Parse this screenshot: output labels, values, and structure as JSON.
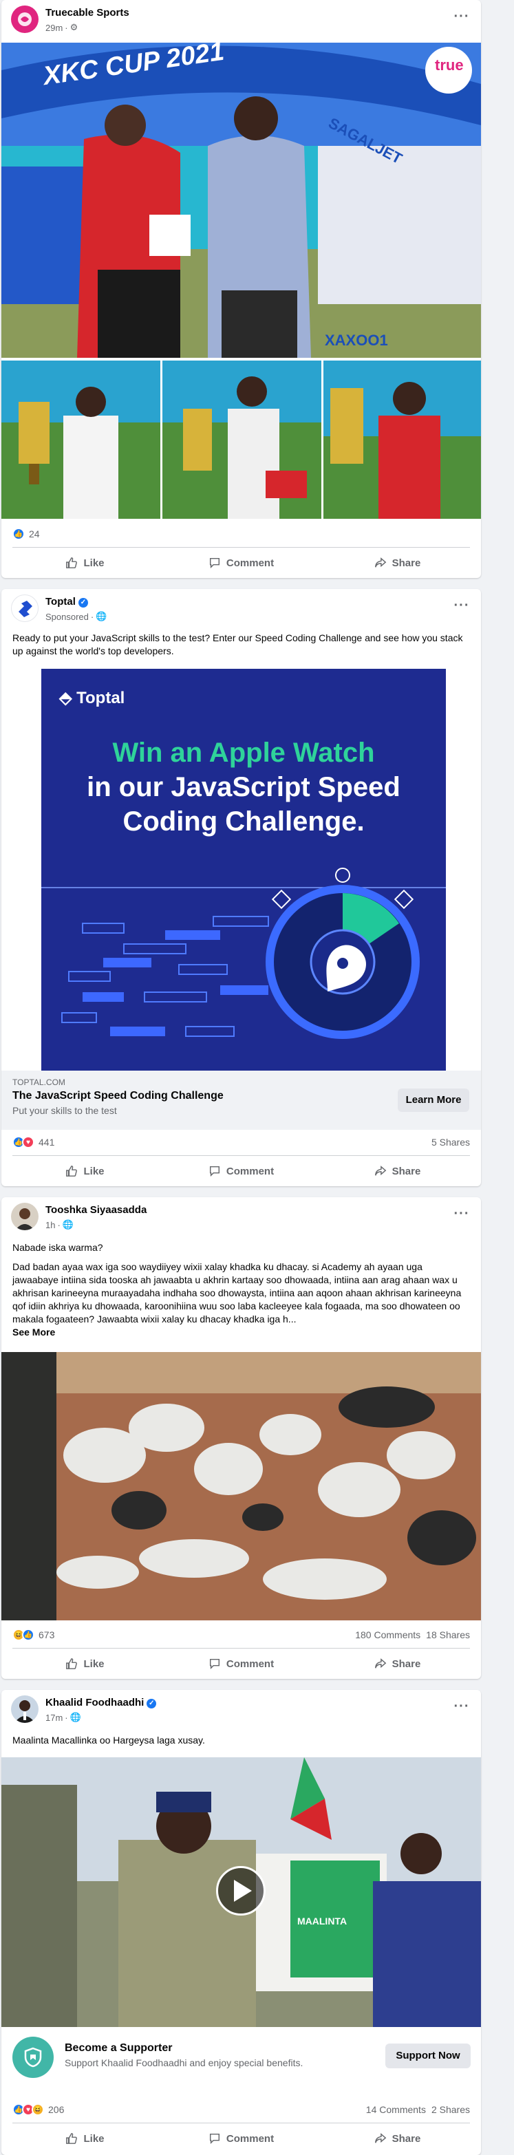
{
  "posts": [
    {
      "author": "Truecable Sports",
      "time": "29m",
      "privacy_icon": "settings-icon",
      "images": {
        "main_alt": "XKC CUP 2021",
        "banner_text": "XKC CUP 2021",
        "sponsor": "SAGALJET",
        "watermark": "true",
        "side_text": "XAXOO1"
      },
      "reaction_count": "24",
      "actions": {
        "like": "Like",
        "comment": "Comment",
        "share": "Share"
      }
    },
    {
      "author": "Toptal",
      "sponsored": "Sponsored",
      "text": "Ready to put your JavaScript skills to the test? Enter our Speed Coding Challenge and see how you stack up against the world's top developers.",
      "ad": {
        "brand": "Toptal",
        "headline_line1": "Win an Apple Watch",
        "headline_line2": "in our JavaScript Speed",
        "headline_line3": "Coding Challenge."
      },
      "link": {
        "domain": "TOPTAL.COM",
        "title": "The JavaScript Speed Coding Challenge",
        "subtitle": "Put your skills to the test",
        "button": "Learn More"
      },
      "reaction_count": "441",
      "shares": "5 Shares",
      "actions": {
        "like": "Like",
        "comment": "Comment",
        "share": "Share"
      }
    },
    {
      "author": "Tooshka Siyaasadda",
      "time": "1h",
      "text_title": "Nabade iska warma?",
      "text": "Dad badan ayaa wax  iga soo waydiiyey  wixii xalay khadka ku dhacay.  si Academy ah ayaan uga jawaabaye  intiina sida tooska ah jawaabta  u akhrin kartaay soo dhowaada, intiina aan arag ahaan wax u akhrisan karineeyna muraayadaha indhaha soo dhowaysta, intiina aan aqoon ahaan akhrisan karineeyna qof idiin akhriya ku dhowaada, karoonihiina wuu soo laba kacleeyee kala fogaada, ma soo dhowateen oo makala fogaateen? Jawaabta wixii xalay ku dhacay khadka iga h...",
      "see_more": "See More",
      "reaction_count": "673",
      "comments": "180 Comments",
      "shares": "18 Shares",
      "actions": {
        "like": "Like",
        "comment": "Comment",
        "share": "Share"
      }
    },
    {
      "author": "Khaalid Foodhaadhi",
      "time": "17m",
      "text": "Maalinta Macallinka oo Hargeysa laga xusay.",
      "video_sign": "MAALINTA",
      "supporter": {
        "title": "Become a Supporter",
        "subtitle": "Support Khaalid Foodhaadhi and enjoy special benefits.",
        "button": "Support Now"
      },
      "reaction_count": "206",
      "comments": "14 Comments",
      "shares": "2 Shares",
      "actions": {
        "like": "Like",
        "comment": "Comment",
        "share": "Share"
      }
    }
  ]
}
